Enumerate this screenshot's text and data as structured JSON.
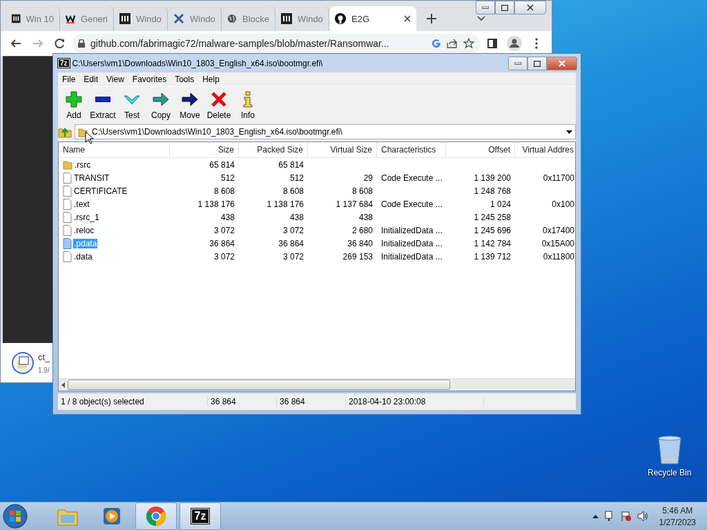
{
  "browser": {
    "tabs": [
      {
        "title": "Win 10",
        "kind": "columns",
        "selected": false
      },
      {
        "title": "Generi",
        "kind": "w",
        "selected": false
      },
      {
        "title": "Windo",
        "kind": "columns",
        "selected": false
      },
      {
        "title": "Windo",
        "kind": "x",
        "selected": false
      },
      {
        "title": "Blocke",
        "kind": "globe",
        "selected": false
      },
      {
        "title": "Windo",
        "kind": "columns",
        "selected": false
      },
      {
        "title": "E2G",
        "kind": "github",
        "selected": true
      }
    ],
    "nav": [
      {
        "kind": "back",
        "disabled": false
      },
      {
        "kind": "forward",
        "disabled": true
      },
      {
        "kind": "reload",
        "disabled": false
      }
    ],
    "url": "github.com/fabrimagic72/malware-samples/blob/master/Ransomwar...",
    "download": {
      "name": "ct_",
      "status": "1.9/"
    }
  },
  "archiver": {
    "logo": "7z",
    "title": "C:\\Users\\vm1\\Downloads\\Win10_1803_English_x64.iso\\bootmgr.efi\\",
    "menu": [
      "File",
      "Edit",
      "View",
      "Favorites",
      "Tools",
      "Help"
    ],
    "toolbar": [
      {
        "label": "Add",
        "kind": "add"
      },
      {
        "label": "Extract",
        "kind": "extract"
      },
      {
        "label": "Test",
        "kind": "test"
      },
      {
        "label": "Copy",
        "kind": "copy"
      },
      {
        "label": "Move",
        "kind": "move"
      },
      {
        "label": "Delete",
        "kind": "delete"
      },
      {
        "label": "Info",
        "kind": "info"
      }
    ],
    "path": "C:\\Users\\vm1\\Downloads\\Win10_1803_English_x64.iso\\bootmgr.efi\\",
    "columns": [
      "Name",
      "Size",
      "Packed Size",
      "Virtual Size",
      "Characteristics",
      "Offset",
      "Virtual Addres"
    ],
    "rows": [
      {
        "kind": "folder",
        "selected": false,
        "cells": [
          ".rsrc",
          "65 814",
          "65 814",
          null,
          null,
          null,
          null
        ]
      },
      {
        "kind": "file",
        "selected": false,
        "cells": [
          "TRANSIT",
          "512",
          "512",
          "29",
          "Code Execute ...",
          "1 139 200",
          "0x11700"
        ]
      },
      {
        "kind": "file",
        "selected": false,
        "cells": [
          "CERTIFICATE",
          "8 608",
          "8 608",
          "8 608",
          null,
          "1 248 768",
          null
        ]
      },
      {
        "kind": "file",
        "selected": false,
        "cells": [
          ".text",
          "1 138 176",
          "1 138 176",
          "1 137 684",
          "Code Execute ...",
          "1 024",
          "0x100"
        ]
      },
      {
        "kind": "file",
        "selected": false,
        "cells": [
          ".rsrc_1",
          "438",
          "438",
          "438",
          null,
          "1 245 258",
          null
        ]
      },
      {
        "kind": "file",
        "selected": false,
        "cells": [
          ".reloc",
          "3 072",
          "3 072",
          "2 680",
          "InitializedData ...",
          "1 245 696",
          "0x17400"
        ]
      },
      {
        "kind": "file",
        "selected": true,
        "cells": [
          ".pdata",
          "36 864",
          "36 864",
          "36 840",
          "InitializedData ...",
          "1 142 784",
          "0x15A00"
        ]
      },
      {
        "kind": "file",
        "selected": false,
        "cells": [
          ".data",
          "3 072",
          "3 072",
          "269 153",
          "InitializedData ...",
          "1 139 712",
          "0x11800"
        ]
      }
    ],
    "status": [
      "1 / 8 object(s) selected",
      "36 864",
      "36 864",
      "2018-04-10 23:00:08"
    ]
  },
  "desktop_icons": [
    {
      "label": "Recycle Bin",
      "kind": "recycle"
    }
  ],
  "taskbar": {
    "items": [
      {
        "kind": "explorer",
        "active": false
      },
      {
        "kind": "media",
        "active": false
      },
      {
        "kind": "chrome",
        "active": true
      },
      {
        "kind": "archiver",
        "active": true,
        "label": "7z"
      }
    ],
    "time": "5:46 AM",
    "date": "1/27/2023"
  }
}
